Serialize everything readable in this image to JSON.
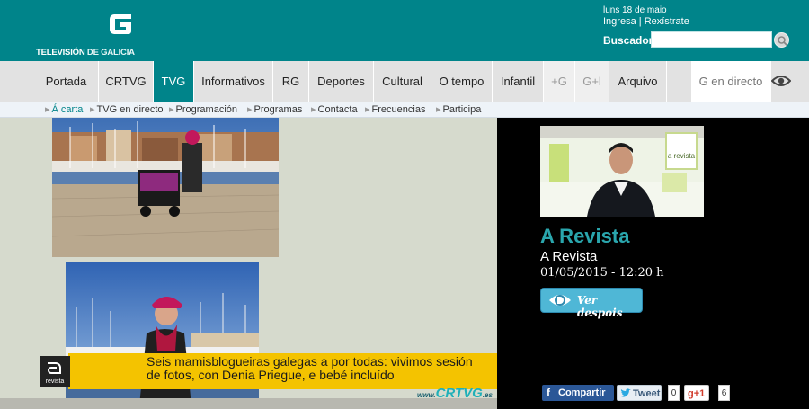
{
  "header": {
    "brand_part1": "TELEVISIÓN ",
    "brand_part2": "DE GALICIA",
    "date": "luns 18 de maio",
    "login": "Ingresa",
    "separator": " | ",
    "register": "Rexístrate",
    "search_label": "Buscador",
    "search_value": "",
    "colors": {
      "bar": "#00848a",
      "accent": "#2aa6ad"
    }
  },
  "nav": {
    "items": [
      {
        "label": "Portada"
      },
      {
        "label": "CRTVG"
      },
      {
        "label": "TVG",
        "active": true
      },
      {
        "label": "Informativos"
      },
      {
        "label": "RG"
      },
      {
        "label": "Deportes"
      },
      {
        "label": "Cultural"
      },
      {
        "label": "O tempo"
      },
      {
        "label": "Infantil"
      },
      {
        "label": "+G"
      },
      {
        "label": "G+l"
      },
      {
        "label": "Arquivo"
      },
      {
        "label": "G en directo"
      }
    ],
    "eye_icon": "eye-icon"
  },
  "subnav": {
    "items": [
      {
        "label": "Á carta",
        "active": true
      },
      {
        "label": "TVG en directo"
      },
      {
        "label": "Programación"
      },
      {
        "label": "Programas"
      },
      {
        "label": "Contacta"
      },
      {
        "label": "Frecuencias"
      },
      {
        "label": "Participa"
      }
    ]
  },
  "video": {
    "lower_third_logo": "revista",
    "lower_third_text": "Seis mamisblogueiras galegas a por todas: vivimos sesión de fotos, con Denia Priegue, e bebé incluído",
    "watermark_prefix": "www.",
    "watermark": "CRTVG",
    "watermark_suffix": ".es"
  },
  "program": {
    "thumb_logo": "a revista",
    "title": "A Revista",
    "subtitle": "A Revista",
    "date": "01/05/2015 - 12:20 h",
    "watch_label": "Ver despois"
  },
  "share": {
    "facebook": "Compartir",
    "twitter": "Tweet",
    "twitter_count": "0",
    "gplus": "g+1",
    "gplus_count": "6"
  }
}
